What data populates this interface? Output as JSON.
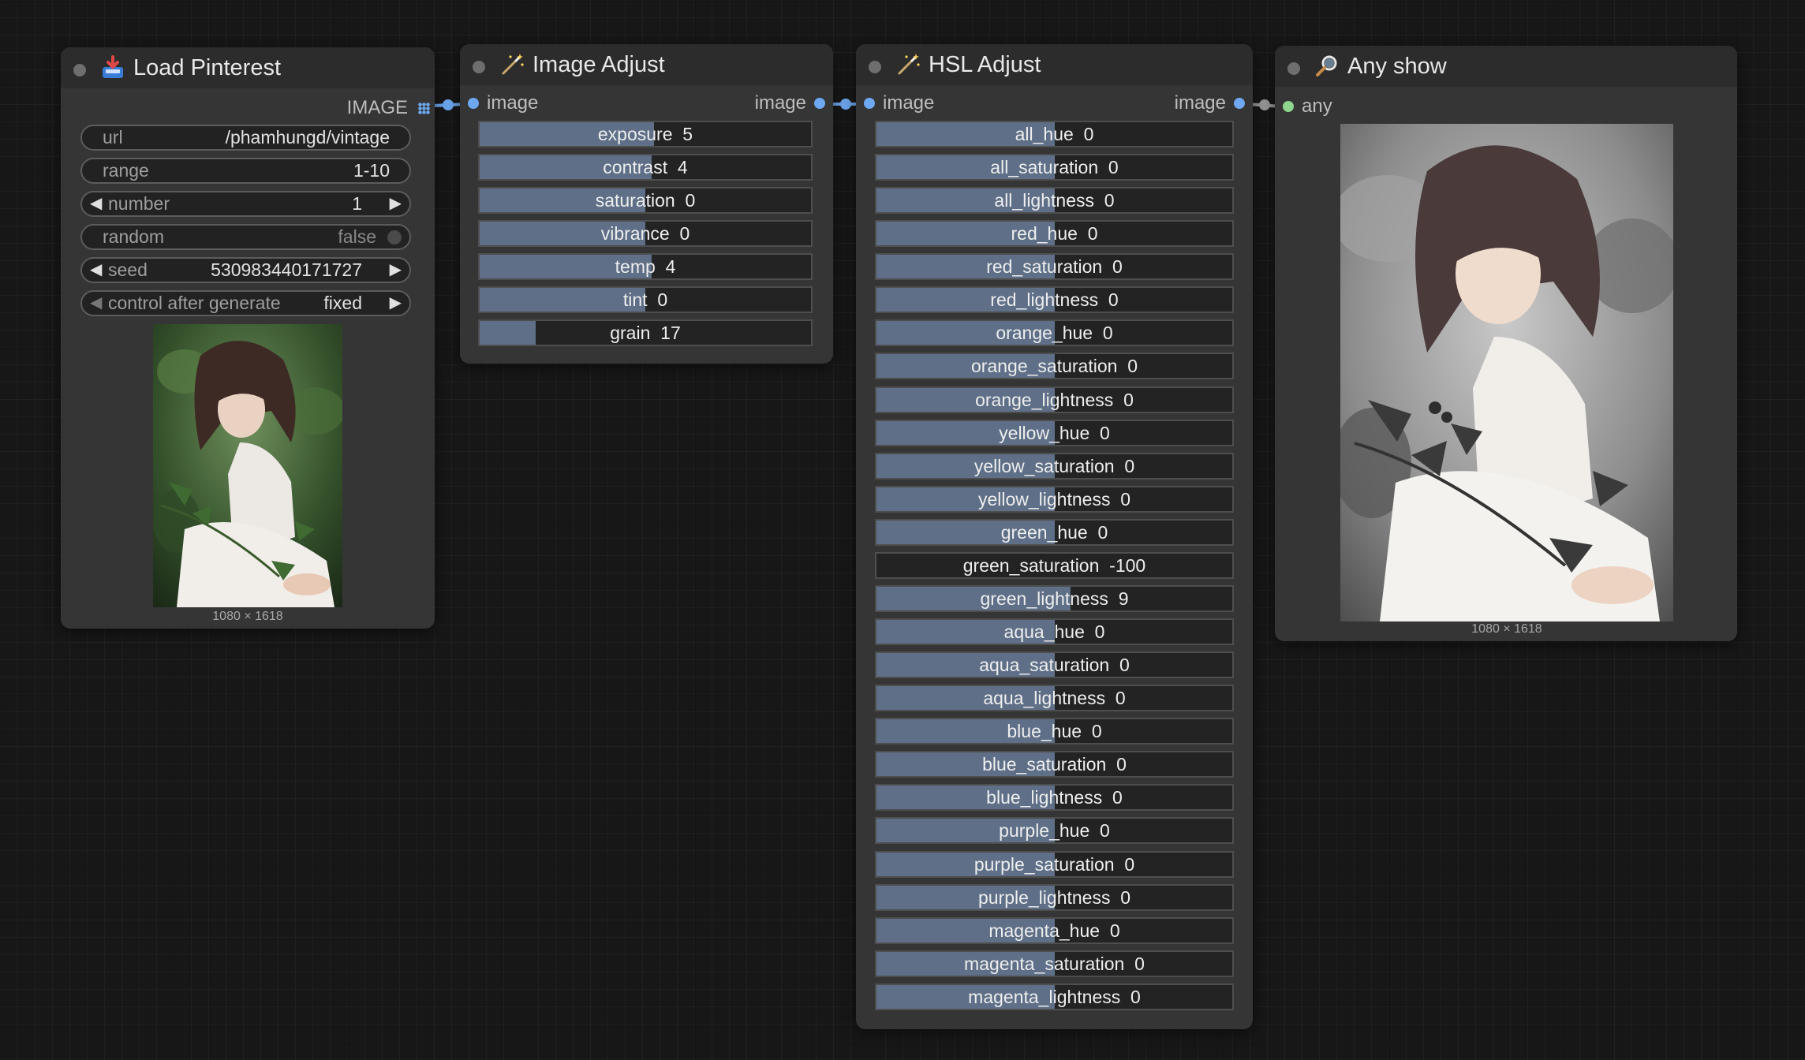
{
  "load_pinterest": {
    "title": "Load Pinterest",
    "output_label": "IMAGE",
    "widgets": {
      "url": {
        "label": "url",
        "value": "/phamhungd/vintage"
      },
      "range": {
        "label": "range",
        "value": "1-10"
      },
      "number": {
        "label": "number",
        "value": "1"
      },
      "random": {
        "label": "random",
        "value": "false"
      },
      "seed": {
        "label": "seed",
        "value": "530983440171727"
      },
      "control": {
        "label": "control after generate",
        "value": "fixed"
      }
    },
    "preview_size": "1080 × 1618"
  },
  "image_adjust": {
    "title": "Image Adjust",
    "input_label": "image",
    "output_label": "image",
    "sliders": [
      {
        "label": "exposure",
        "value": "5",
        "fill": 0.525
      },
      {
        "label": "contrast",
        "value": "4",
        "fill": 0.52
      },
      {
        "label": "saturation",
        "value": "0",
        "fill": 0.5
      },
      {
        "label": "vibrance",
        "value": "0",
        "fill": 0.5
      },
      {
        "label": "temp",
        "value": "4",
        "fill": 0.52
      },
      {
        "label": "tint",
        "value": "0",
        "fill": 0.5
      },
      {
        "label": "grain",
        "value": "17",
        "fill": 0.17
      }
    ]
  },
  "hsl_adjust": {
    "title": "HSL Adjust",
    "input_label": "image",
    "output_label": "image",
    "sliders": [
      {
        "label": "all_hue",
        "value": "0",
        "fill": 0.5
      },
      {
        "label": "all_saturation",
        "value": "0",
        "fill": 0.5
      },
      {
        "label": "all_lightness",
        "value": "0",
        "fill": 0.5
      },
      {
        "label": "red_hue",
        "value": "0",
        "fill": 0.5
      },
      {
        "label": "red_saturation",
        "value": "0",
        "fill": 0.5
      },
      {
        "label": "red_lightness",
        "value": "0",
        "fill": 0.5
      },
      {
        "label": "orange_hue",
        "value": "0",
        "fill": 0.5
      },
      {
        "label": "orange_saturation",
        "value": "0",
        "fill": 0.5
      },
      {
        "label": "orange_lightness",
        "value": "0",
        "fill": 0.5
      },
      {
        "label": "yellow_hue",
        "value": "0",
        "fill": 0.5
      },
      {
        "label": "yellow_saturation",
        "value": "0",
        "fill": 0.5
      },
      {
        "label": "yellow_lightness",
        "value": "0",
        "fill": 0.5
      },
      {
        "label": "green_hue",
        "value": "0",
        "fill": 0.5
      },
      {
        "label": "green_saturation",
        "value": "-100",
        "fill": 0
      },
      {
        "label": "green_lightness",
        "value": "9",
        "fill": 0.545
      },
      {
        "label": "aqua_hue",
        "value": "0",
        "fill": 0.5
      },
      {
        "label": "aqua_saturation",
        "value": "0",
        "fill": 0.5
      },
      {
        "label": "aqua_lightness",
        "value": "0",
        "fill": 0.5
      },
      {
        "label": "blue_hue",
        "value": "0",
        "fill": 0.5
      },
      {
        "label": "blue_saturation",
        "value": "0",
        "fill": 0.5
      },
      {
        "label": "blue_lightness",
        "value": "0",
        "fill": 0.5
      },
      {
        "label": "purple_hue",
        "value": "0",
        "fill": 0.5
      },
      {
        "label": "purple_saturation",
        "value": "0",
        "fill": 0.5
      },
      {
        "label": "purple_lightness",
        "value": "0",
        "fill": 0.5
      },
      {
        "label": "magenta_hue",
        "value": "0",
        "fill": 0.5
      },
      {
        "label": "magenta_saturation",
        "value": "0",
        "fill": 0.5
      },
      {
        "label": "magenta_lightness",
        "value": "0",
        "fill": 0.5
      }
    ]
  },
  "any_show": {
    "title": "Any show",
    "input_label": "any",
    "preview_size": "1080 × 1618"
  },
  "colors": {
    "canvas": "#171717",
    "node_body": "#353535",
    "node_header": "#2c2c2c",
    "slider_fill": "#5e6f87",
    "image_slot": "#6ea8f0",
    "any_slot": "#8fd68f"
  }
}
